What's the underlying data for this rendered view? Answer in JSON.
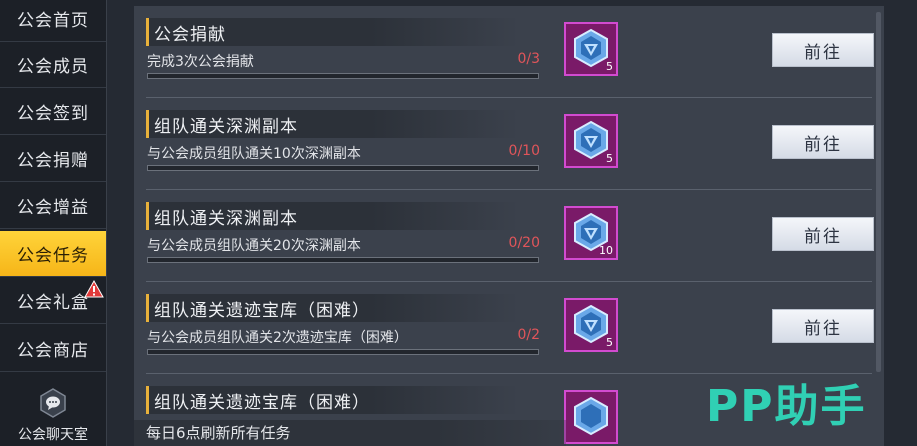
{
  "sidebar": {
    "items": [
      {
        "label": "公会首页"
      },
      {
        "label": "公会成员"
      },
      {
        "label": "公会签到"
      },
      {
        "label": "公会捐赠"
      },
      {
        "label": "公会增益"
      },
      {
        "label": "公会任务"
      },
      {
        "label": "公会礼盒"
      },
      {
        "label": "公会商店"
      }
    ],
    "chat_label": "公会聊天室",
    "active_index": 5,
    "active_color": "#f6b518",
    "alert_icon": "warning-icon"
  },
  "tasks": [
    {
      "title": "公会捐献",
      "desc": "完成3次公会捐献",
      "count": "0/3",
      "progress": 0,
      "reward_qty": "5",
      "button": "前往"
    },
    {
      "title": "组队通关深渊副本",
      "desc": "与公会成员组队通关10次深渊副本",
      "count": "0/10",
      "progress": 0,
      "reward_qty": "5",
      "button": "前往"
    },
    {
      "title": "组队通关深渊副本",
      "desc": "与公会成员组队通关20次深渊副本",
      "count": "0/20",
      "progress": 0,
      "reward_qty": "10",
      "button": "前往"
    },
    {
      "title": "组队通关遗迹宝库（困难）",
      "desc": "与公会成员组队通关2次遗迹宝库（困难）",
      "count": "0/2",
      "progress": 0,
      "reward_qty": "5",
      "button": "前往"
    },
    {
      "title": "组队通关遗迹宝库（困难）",
      "desc": "",
      "count": "",
      "progress": 0,
      "reward_qty": "",
      "button": ""
    }
  ],
  "reward_icon": "guild-badge-icon",
  "footer_text": "每日6点刷新所有任务",
  "watermark": "PP助手",
  "colors": {
    "accent": "#e8b13b",
    "count_red": "#e0555a",
    "reward_frame": "#d24bd0",
    "watermark": "#2fe0c0"
  }
}
